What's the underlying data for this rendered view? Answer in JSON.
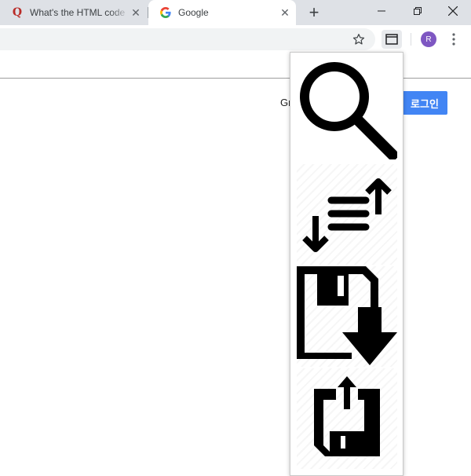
{
  "browser": {
    "tabs": [
      {
        "title": "What's the HTML code",
        "favicon": "quora-q-icon",
        "favicon_letter": "Q",
        "favicon_color": "#b92b27",
        "active": false
      },
      {
        "title": "Google",
        "favicon": "google-g-icon",
        "active": true
      }
    ],
    "new_tab_label": "+",
    "window_controls": [
      "minimize-icon",
      "restore-icon",
      "close-icon"
    ],
    "toolbar": {
      "bookmark_icon": "star-icon",
      "extension_icon": "window-icon",
      "avatar_letter": "R",
      "avatar_color": "#7e57c2",
      "menu_icon": "vertical-dots-icon"
    }
  },
  "page": {
    "gmail_link_partial": "Gr",
    "login_button": "로그인",
    "login_color": "#4285f4"
  },
  "extension_popup": {
    "icons": [
      {
        "name": "search-icon"
      },
      {
        "name": "sort-icon"
      },
      {
        "name": "save-download-icon"
      },
      {
        "name": "save-upload-icon"
      }
    ]
  }
}
